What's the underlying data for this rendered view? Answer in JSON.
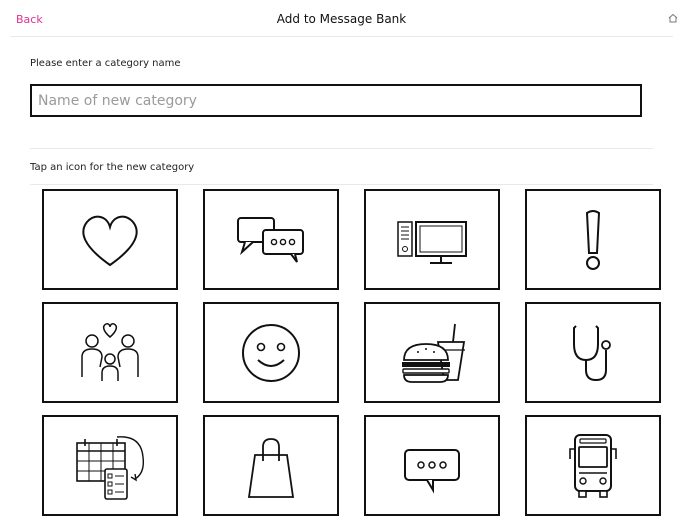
{
  "header": {
    "back_label": "Back",
    "title": "Add to Message Bank",
    "home_icon": "home-icon"
  },
  "category": {
    "prompt": "Please enter a category name",
    "placeholder": "Name of new category",
    "value": ""
  },
  "icons": {
    "prompt": "Tap an icon for the new category",
    "items": [
      "heart-icon",
      "chat-bubbles-icon",
      "television-icon",
      "exclamation-icon",
      "family-icon",
      "smiley-icon",
      "fast-food-icon",
      "stethoscope-icon",
      "calendar-checklist-icon",
      "shopping-bag-icon",
      "speech-bubble-icon",
      "bus-icon"
    ]
  },
  "colors": {
    "accent": "#e0318f",
    "border": "#111111",
    "placeholder": "#9a9a9a"
  }
}
